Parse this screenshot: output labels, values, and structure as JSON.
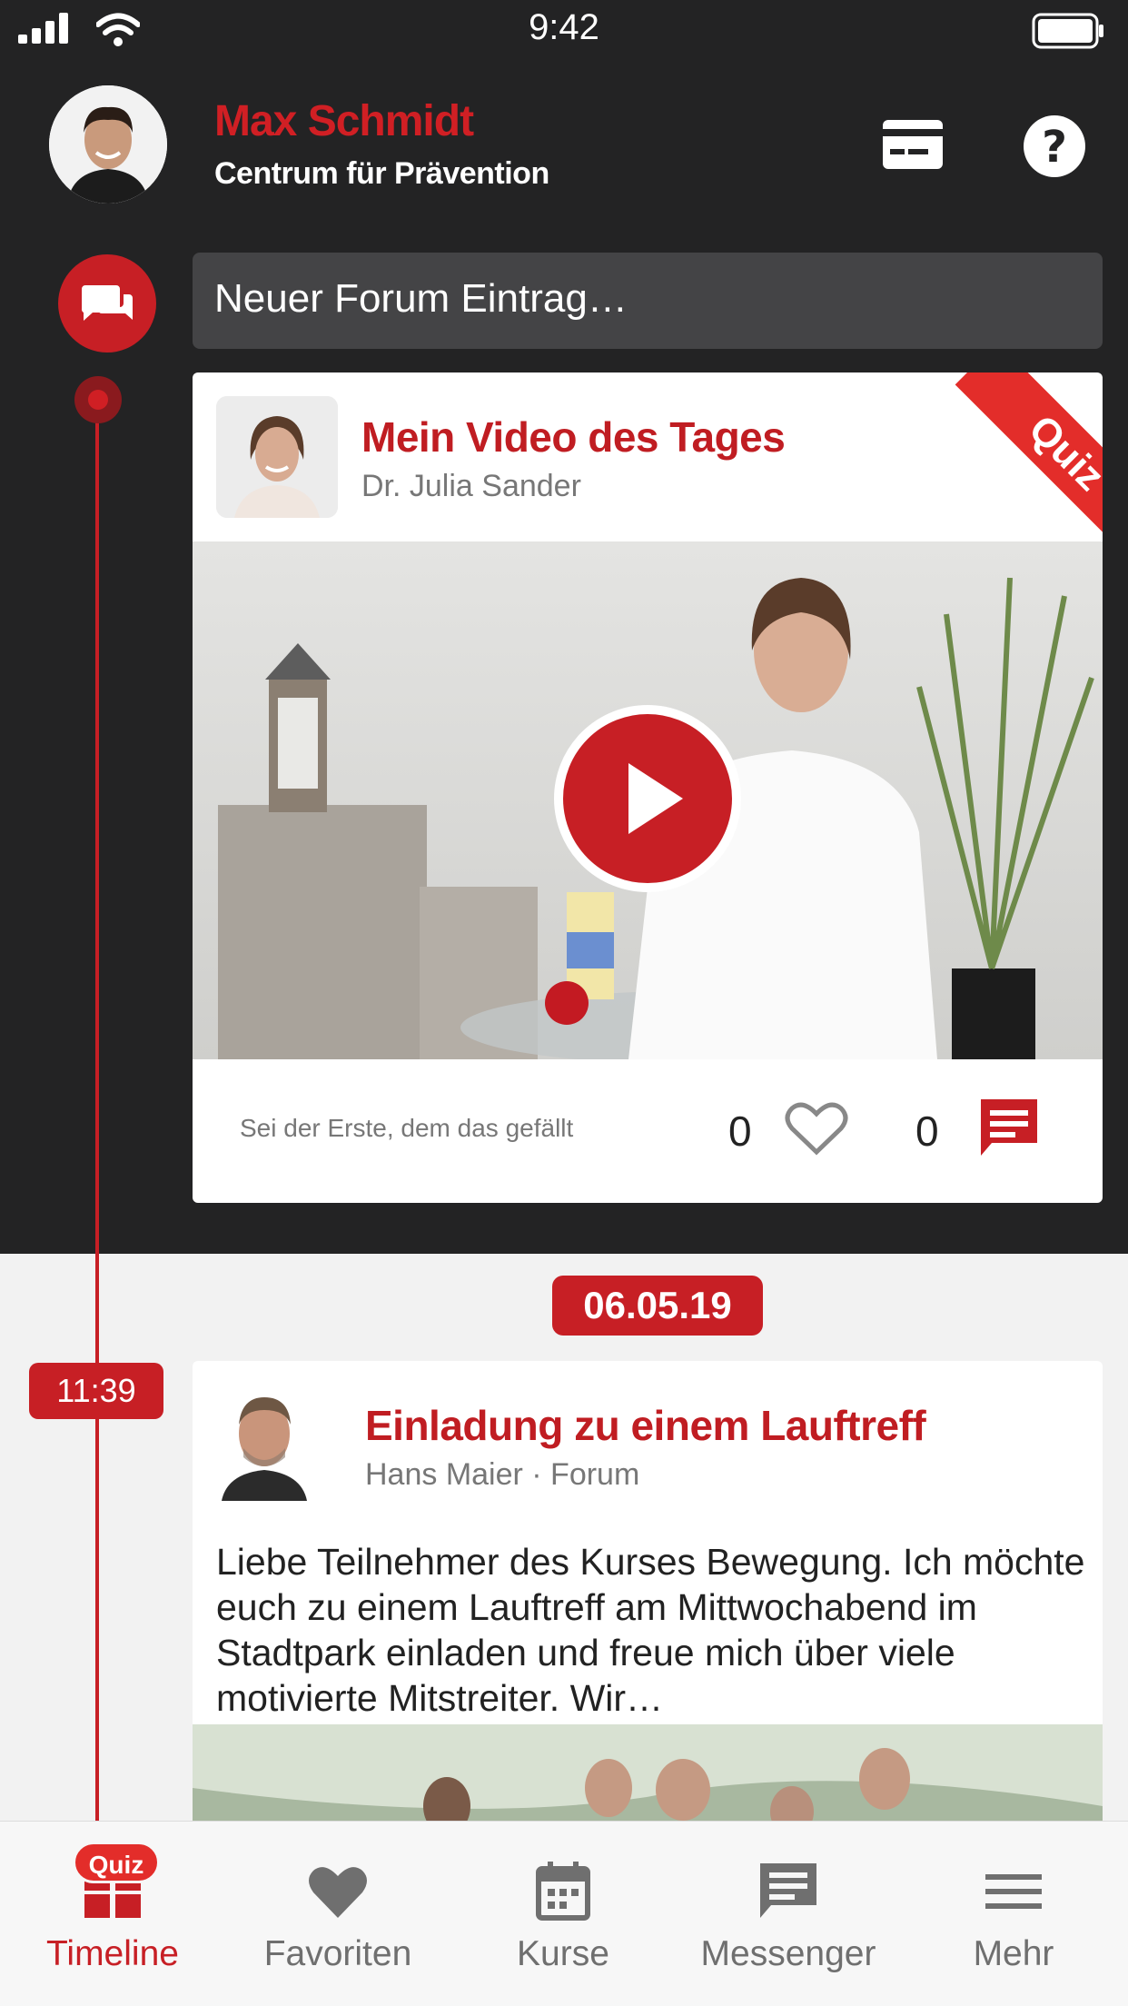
{
  "status_bar": {
    "time": "9:42"
  },
  "header": {
    "user_name": "Max Schmidt",
    "organization": "Centrum für Prävention",
    "card_icon": "card-icon",
    "help_icon": "help-icon"
  },
  "forum_compose": {
    "placeholder": "Neuer Forum Eintrag…",
    "icon": "forum-icon"
  },
  "video_post": {
    "title": "Mein Video des Tages",
    "author": "Dr. Julia Sander",
    "badge": "Quiz",
    "likes_text": "Sei der Erste, dem das gefällt",
    "like_count": "0",
    "comment_count": "0"
  },
  "date_separator": "06.05.19",
  "forum_post": {
    "time": "11:39",
    "title": "Einladung zu einem Lauftreff",
    "meta": "Hans Maier · Forum",
    "body": "Liebe Teilnehmer des Kurses Bewegung. Ich möchte euch zu einem Lauftreff am Mittwochabend im Stadtpark einladen und freue mich über viele motivierte Mitstreiter. Wir…"
  },
  "tabbar": {
    "quiz_badge": "Quiz",
    "tabs": [
      {
        "label": "Timeline",
        "icon": "timeline-icon",
        "active": true
      },
      {
        "label": "Favoriten",
        "icon": "heart-icon"
      },
      {
        "label": "Kurse",
        "icon": "calendar-icon"
      },
      {
        "label": "Messenger",
        "icon": "message-icon"
      },
      {
        "label": "Mehr",
        "icon": "menu-icon"
      }
    ]
  },
  "colors": {
    "brand_red": "#c71f25",
    "dark_bg": "#232324"
  }
}
